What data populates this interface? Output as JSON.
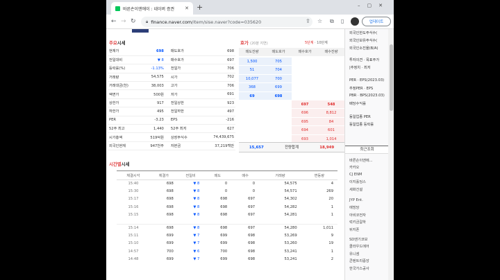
{
  "browser": {
    "tab_title": "바른손이앤에이 : 네이버 증권",
    "url_host": "finance.naver.com",
    "url_rest": "/item/sise.naver?code=035620",
    "update_label": "업데이트"
  },
  "left": {
    "section_title_a": "주요",
    "section_title_b": "시세",
    "quote_rows": [
      {
        "l1": "현재가",
        "v1": "698",
        "l2": "매도호가",
        "v2": "698"
      },
      {
        "l1": "전일대비",
        "v1": "▼ 8",
        "l2": "매수호가",
        "v2": "697"
      },
      {
        "l1": "등락률(%)",
        "v1": "-1.13%",
        "l2": "전일가",
        "v2": "706"
      },
      {
        "l1": "거래량",
        "v1": "54,575",
        "l2": "시가",
        "v2": "702"
      },
      {
        "l1": "거래대금(천)",
        "v1": "38,003",
        "l2": "고가",
        "v2": "706"
      },
      {
        "l1": "액면가",
        "v1": "500원",
        "l2": "저가",
        "v2": "691"
      },
      {
        "l1": "상한가",
        "v1": "917",
        "l2": "전일상한",
        "v2": "923"
      },
      {
        "l1": "하한가",
        "v1": "495",
        "l2": "전일하한",
        "v2": "497"
      },
      {
        "l1": "PER",
        "v1": "-3.23",
        "l2": "EPS",
        "v2": "-216"
      },
      {
        "l1": "52주 최고",
        "v1": "1,440",
        "l2": "52주 최저",
        "v2": "627"
      },
      {
        "l1": "시가총액",
        "v1": "519억원",
        "l2": "상장주식수",
        "v2": "74,439,675"
      },
      {
        "l1": "외국인현재",
        "v1": "947천주",
        "l2": "자본금",
        "v2": "37,219백만"
      }
    ],
    "hoga_title_a": "호가",
    "hoga_title_b": "(20분 지연)",
    "hoga_opt1": "5단계",
    "hoga_opt2": "10단계",
    "hoga_headers": [
      "매도잔량",
      "매도호가",
      "매수호가",
      "매수잔량"
    ],
    "sell_rows": [
      [
        "1,500",
        "705"
      ],
      [
        "51",
        "704"
      ],
      [
        "10,077",
        "700"
      ],
      [
        "368",
        "699"
      ],
      [
        "69",
        "698"
      ]
    ],
    "buy_rows": [
      [
        "697",
        "548"
      ],
      [
        "696",
        "8,812"
      ],
      [
        "695",
        "84"
      ],
      [
        "694",
        "601"
      ],
      [
        "693",
        "1,014"
      ]
    ],
    "hoga_sum": [
      "15,657",
      "잔량합계",
      "18,949"
    ],
    "time_title_a": "시간별",
    "time_title_b": "시세",
    "time_headers": [
      "체결시각",
      "체결가",
      "전일비",
      "매도",
      "매수",
      "거래량",
      "변동량"
    ],
    "time_rows": [
      [
        "15:40",
        "698",
        "▼ 8",
        "0",
        "0",
        "54,575",
        "4"
      ],
      [
        "15:30",
        "698",
        "▼ 8",
        "0",
        "0",
        "54,571",
        "269"
      ],
      [
        "15:17",
        "698",
        "▼ 8",
        "698",
        "697",
        "54,302",
        "20"
      ],
      [
        "15:16",
        "698",
        "▼ 8",
        "698",
        "697",
        "54,282",
        "1"
      ],
      [
        "15:15",
        "698",
        "▼ 8",
        "698",
        "697",
        "54,281",
        "1"
      ],
      [
        "15:14",
        "698",
        "▼ 8",
        "698",
        "697",
        "54,280",
        "1,011"
      ],
      [
        "15:11",
        "699",
        "▼ 7",
        "699",
        "698",
        "53,269",
        "9"
      ],
      [
        "15:10",
        "699",
        "▼ 7",
        "699",
        "698",
        "53,260",
        "19"
      ],
      [
        "14:57",
        "700",
        "▼ 6",
        "700",
        "698",
        "53,241",
        "1"
      ],
      [
        "14:48",
        "699",
        "▼ 7",
        "699",
        "698",
        "53,241",
        "2"
      ]
    ]
  },
  "right": {
    "top_items": [
      "외국인한도주식수(",
      "외국인보유주식수(",
      "외국인소진율(B/A)"
    ],
    "mid_items": [
      "투자의견 · 목표주가",
      "|추정치 · 최저"
    ],
    "per_items": [
      "PER · EPS(2023.03)",
      "추정PER · EPS",
      "PBR · BPS(2023.03)",
      "배당수익률"
    ],
    "sector_items": [
      "동일업종 PER",
      "동일업종 등락률"
    ],
    "recent_title": "최근조회",
    "recent": [
      "바른손이앤에...",
      "카카오",
      "CJ ENM",
      "이지홀딩스",
      "세화건설",
      "JYP Ent.",
      "에빙당",
      "아비코전자",
      "럭키금갈하",
      "뒤지폰",
      "SD엔기코보",
      "콜라우드에어",
      "유니셈",
      "콘텐트리중앙",
      "한국가스공사"
    ]
  }
}
